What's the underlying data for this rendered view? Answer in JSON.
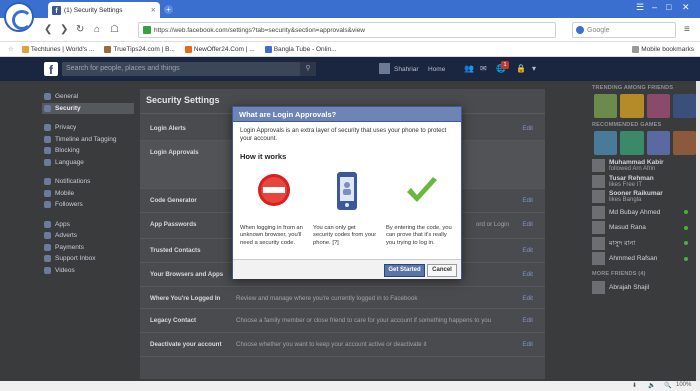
{
  "browser": {
    "tab_title": "(1) Security Settings",
    "url": "https://web.facebook.com/settings?tab=security&section=approvals&view",
    "search_placeholder": "Google",
    "bookmarks": [
      "Techtunes | World's ...",
      "TrueTips24.com | B...",
      "NewOffer24.Com | ...",
      "Bangla Tube - Onlin..."
    ],
    "mobile_bookmarks": "Mobile bookmarks",
    "zoom": "100%",
    "colors": {
      "chrome": "#3a6fd0",
      "lock": "#35a33b"
    }
  },
  "facebook": {
    "logo": "f",
    "search_placeholder": "Search for people, places and things",
    "user_name": "Shahriar",
    "home": "Home",
    "notification_count": "1",
    "colors": {
      "bar": "#1a2640",
      "brand": "#3b5998"
    }
  },
  "sidebar": {
    "items": [
      {
        "label": "General",
        "icon": "gear-icon"
      },
      {
        "label": "Security",
        "icon": "shield-icon",
        "active": true
      },
      {
        "label": "Privacy",
        "icon": "lock-icon"
      },
      {
        "label": "Timeline and Tagging",
        "icon": "timeline-icon"
      },
      {
        "label": "Blocking",
        "icon": "block-icon"
      },
      {
        "label": "Language",
        "icon": "globe-icon"
      },
      {
        "label": "Notifications",
        "icon": "globe-icon"
      },
      {
        "label": "Mobile",
        "icon": "mobile-icon"
      },
      {
        "label": "Followers",
        "icon": "rss-icon"
      },
      {
        "label": "Apps",
        "icon": "apps-icon"
      },
      {
        "label": "Adverts",
        "icon": "adverts-icon"
      },
      {
        "label": "Payments",
        "icon": "card-icon"
      },
      {
        "label": "Support Inbox",
        "icon": "support-icon"
      },
      {
        "label": "Videos",
        "icon": "video-icon"
      }
    ]
  },
  "settings": {
    "title": "Security Settings",
    "rows": [
      {
        "label": "Login Alerts",
        "edit": "Edit",
        "desc": ""
      },
      {
        "label": "Login Approvals",
        "edit": "",
        "desc": ""
      },
      {
        "label": "Code Generator",
        "edit": "Edit",
        "desc": ""
      },
      {
        "label": "App Passwords",
        "edit": "Edit",
        "desc": "ord or Login"
      },
      {
        "label": "Trusted Contacts",
        "edit": "Edit",
        "desc": ""
      },
      {
        "label": "Your Browsers and Apps",
        "edit": "Edit",
        "desc": ""
      },
      {
        "label": "Where You're Logged In",
        "edit": "Edit",
        "desc": "Review and manage where you're currently logged in to Facebook"
      },
      {
        "label": "Legacy Contact",
        "edit": "Edit",
        "desc": "Choose a family member or close friend to care for your account if something happens to you"
      },
      {
        "label": "Deactivate your account",
        "edit": "Edit",
        "desc": "Choose whether you want to keep your account active or deactivate it"
      }
    ]
  },
  "modal": {
    "title": "What are Login Approvals?",
    "intro": "Login Approvals is an extra layer of security that uses your phone to protect your account.",
    "how_it_works": "How it works",
    "steps": [
      {
        "icon": "no-entry-icon",
        "text": "When logging in from an unknown browser, you'll need a security code."
      },
      {
        "icon": "phone-icon",
        "text": "You can only get security codes from your phone. [?]"
      },
      {
        "icon": "checkmark-icon",
        "text": "By entering the code, you can prove that it's really you trying to log in."
      }
    ],
    "primary_button": "Get Started",
    "cancel_button": "Cancel"
  },
  "rightcol": {
    "trending_header": "TRENDING AMONG FRIENDS",
    "see_all": "See All",
    "recommended_header": "RECOMMENDED GAMES",
    "friends": [
      {
        "name": "Muhammad Kabir",
        "sub": "followed Arn Afrin"
      },
      {
        "name": "Tusar Rehman",
        "sub": "likes Free IT"
      },
      {
        "name": "Sooner Raikumar",
        "sub": "likes Bangla"
      },
      {
        "name": "Md Bubay Ahmed",
        "sub": ""
      },
      {
        "name": "Masud Rana",
        "sub": ""
      },
      {
        "name": "মাসুদ রানা",
        "sub": ""
      },
      {
        "name": "Ahmmed Rafsan",
        "sub": ""
      }
    ],
    "more_friends_header": "MORE FRIENDS (4)",
    "more_friends": [
      {
        "name": "Abrajah Shajil"
      }
    ],
    "chat_search": "Search"
  }
}
